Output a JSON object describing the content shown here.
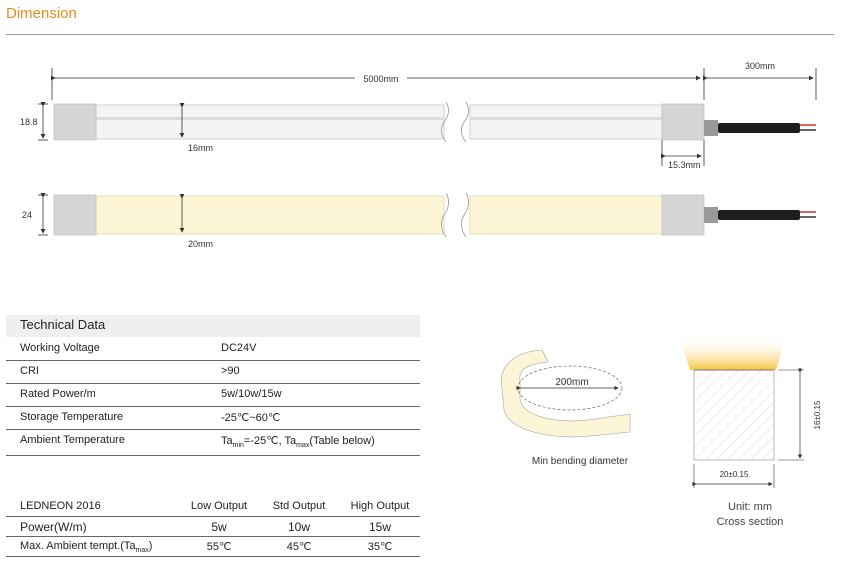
{
  "title": "Dimension",
  "strips": {
    "length": "5000mm",
    "cable": "300mm",
    "cap": "15.3mm",
    "strip1": {
      "height": "18.8",
      "inner": "16mm"
    },
    "strip2": {
      "height": "24",
      "inner": "20mm"
    }
  },
  "technical": {
    "title": "Technical Data",
    "rows": [
      {
        "label": "Working Voltage",
        "value": "DC24V"
      },
      {
        "label": "CRI",
        "value": ">90"
      },
      {
        "label": "Rated Power/m",
        "value": "5w/10w/15w"
      },
      {
        "label": "Storage Temperature",
        "value": "-25℃~60℃"
      }
    ],
    "ambient": {
      "label": "Ambient Temperature",
      "ta": "Ta",
      "min_sub": "min",
      "min_value": "=-25℃, ",
      "max_sub": "max",
      "max_rest": "(Table below)"
    }
  },
  "output_table": {
    "headers": [
      "LEDNEON 2016",
      "Low Output",
      "Std Output",
      "High Output"
    ],
    "power": {
      "label": "Power(W/m)",
      "values": [
        "5w",
        "10w",
        "15w"
      ]
    },
    "ambient": {
      "label": "Max. Ambient tempt.(Ta",
      "sub": "max",
      "close": ")",
      "values": [
        "55℃",
        "45℃",
        "35℃"
      ]
    }
  },
  "bending": {
    "diameter": "200mm",
    "caption": "Min bending diameter"
  },
  "cross_section": {
    "height": "16±0.15",
    "width": "20±0.15",
    "unit": "Unit: mm",
    "caption": "Cross section"
  }
}
